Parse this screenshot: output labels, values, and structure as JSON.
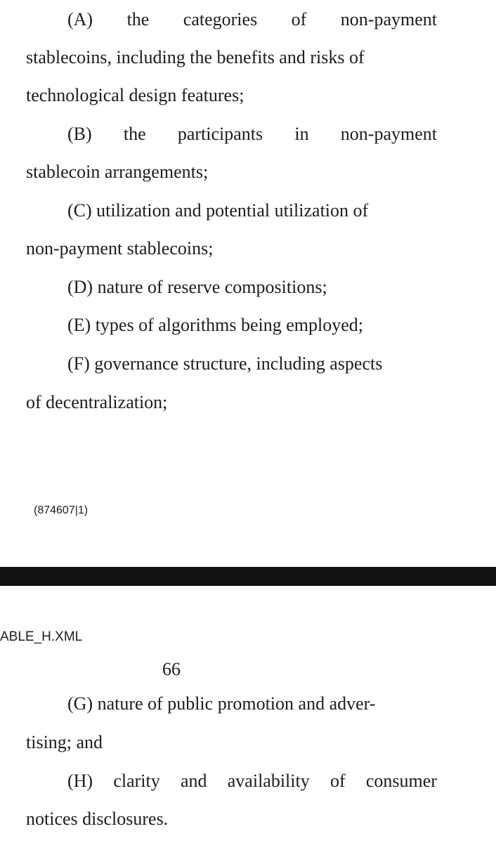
{
  "page_top": {
    "items": [
      {
        "first_line_words": [
          "(A)",
          "the",
          "categories",
          "of",
          "non-payment"
        ],
        "lines": [
          "stablecoins, including the benefits and risks of",
          "technological design features;"
        ]
      },
      {
        "first_line_words": [
          "(B)",
          "the",
          "participants",
          "in",
          "non-payment"
        ],
        "lines": [
          "stablecoin arrangements;"
        ]
      },
      {
        "first_line": "(C) utilization and potential utilization of",
        "lines": [
          "non-payment stablecoins;"
        ]
      },
      {
        "first_line": "(D) nature of reserve compositions;"
      },
      {
        "first_line": "(E) types of algorithms being employed;"
      },
      {
        "first_line": "(F) governance structure, including aspects",
        "lines": [
          "of decentralization;"
        ]
      }
    ],
    "footer_code": "(874607|1)"
  },
  "page_bottom": {
    "file_name": "ABLE_H.XML",
    "page_number": "66",
    "items": [
      {
        "first_line": "(G) nature of public promotion and adver-",
        "lines": [
          "tising; and"
        ]
      },
      {
        "first_line_words": [
          "(H)",
          "clarity",
          "and",
          "availability",
          "of",
          "consumer"
        ],
        "lines": [
          "notices disclosures."
        ]
      }
    ]
  }
}
